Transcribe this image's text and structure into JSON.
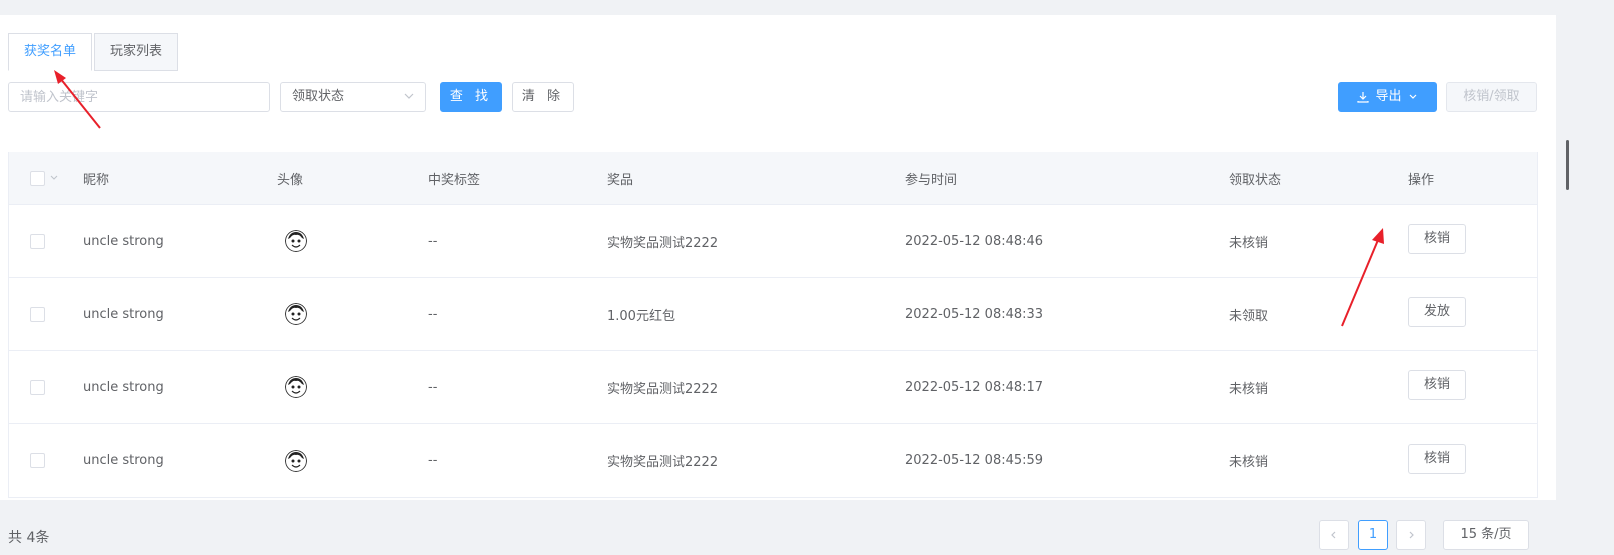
{
  "tabs": [
    {
      "label": "获奖名单",
      "active": true
    },
    {
      "label": "玩家列表",
      "active": false
    }
  ],
  "toolbar": {
    "search_placeholder": "请输入关键字",
    "status_select": "领取状态",
    "search_btn": "查 找",
    "clear_btn": "清 除",
    "export_btn": "导出",
    "verify_btn": "核销/领取"
  },
  "table": {
    "headers": [
      "昵称",
      "头像",
      "中奖标签",
      "奖品",
      "参与时间",
      "领取状态",
      "操作"
    ],
    "rows": [
      {
        "nickname": "uncle strong",
        "tag": "--",
        "prize": "实物奖品测试2222",
        "time": "2022-05-12 08:48:46",
        "status": "未核销",
        "action": "核销"
      },
      {
        "nickname": "uncle strong",
        "tag": "--",
        "prize": "1.00元红包",
        "time": "2022-05-12 08:48:33",
        "status": "未领取",
        "action": "发放"
      },
      {
        "nickname": "uncle strong",
        "tag": "--",
        "prize": "实物奖品测试2222",
        "time": "2022-05-12 08:48:17",
        "status": "未核销",
        "action": "核销"
      },
      {
        "nickname": "uncle strong",
        "tag": "--",
        "prize": "实物奖品测试2222",
        "time": "2022-05-12 08:45:59",
        "status": "未核销",
        "action": "核销"
      }
    ]
  },
  "pagination": {
    "total": "共 4条",
    "current_page": "1",
    "page_size": "15 条/页"
  },
  "colors": {
    "primary": "#409eff",
    "annotation_arrow": "#e8202a"
  }
}
